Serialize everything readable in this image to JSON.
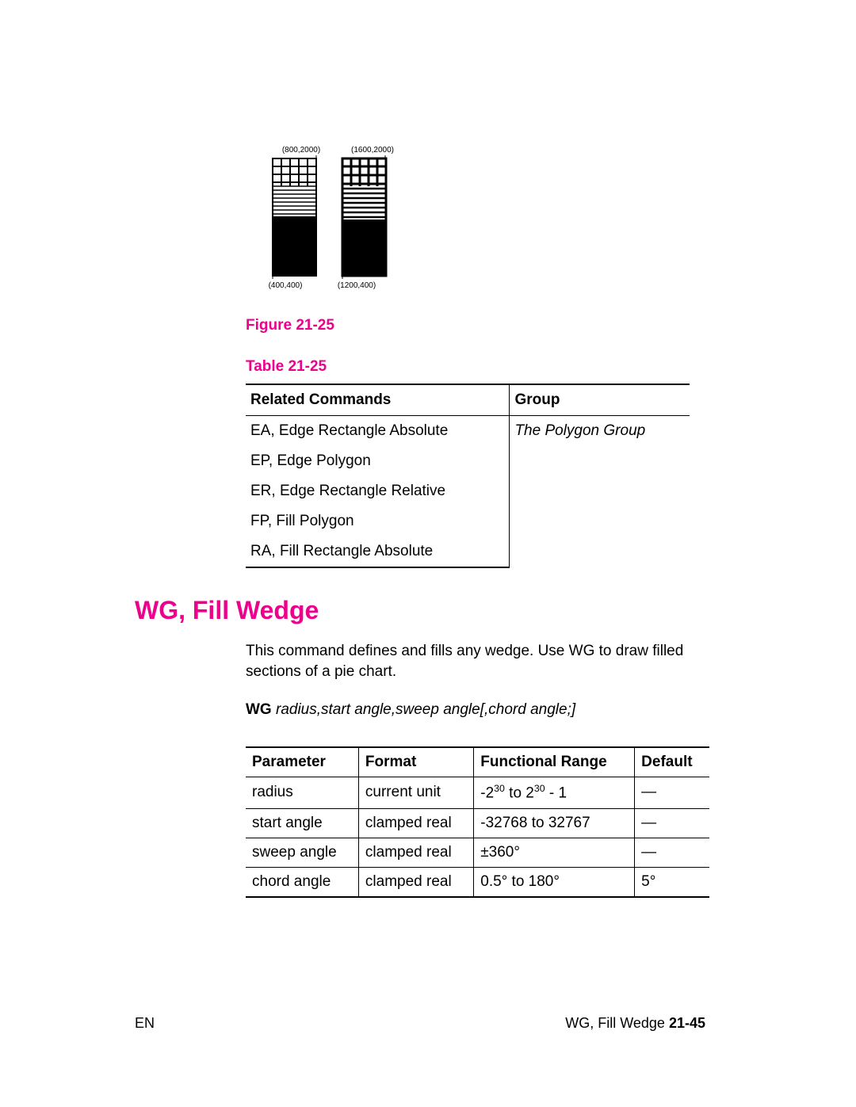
{
  "figure": {
    "caption": "Figure 21-25",
    "coords": {
      "tl": "(800,2000)",
      "tr": "(1600,2000)",
      "bl": "(400,400)",
      "br": "(1200,400)"
    }
  },
  "table1": {
    "caption": "Table 21-25",
    "headers": {
      "c1": "Related Commands",
      "c2": "Group"
    },
    "groupValue": "The Polygon Group",
    "rows": [
      "EA, Edge Rectangle Absolute",
      "EP, Edge Polygon",
      "ER, Edge Rectangle Relative",
      "FP, Fill Polygon",
      "RA, Fill Rectangle Absolute"
    ]
  },
  "section": {
    "title": "WG, Fill Wedge",
    "body": "This command defines and fills any wedge. Use WG to draw filled sections of a pie chart.",
    "syntax_bold": "WG",
    "syntax_italic": " radius,start angle,sweep angle[,chord angle;]"
  },
  "table2": {
    "headers": {
      "c1": "Parameter",
      "c2": "Format",
      "c3": "Functional Range",
      "c4": "Default"
    },
    "rows": [
      {
        "p": "radius",
        "f": "current unit",
        "r_pre": "-2",
        "r_sup1": "30",
        "r_mid": " to 2",
        "r_sup2": "30",
        "r_post": " - 1",
        "d": "—"
      },
      {
        "p": "start angle",
        "f": "clamped real",
        "r_plain": "-32768 to 32767",
        "d": "—"
      },
      {
        "p": "sweep angle",
        "f": "clamped real",
        "r_plain": "±360°",
        "d": "—"
      },
      {
        "p": "chord angle",
        "f": "clamped real",
        "r_plain": "0.5° to 180°",
        "d": "5°"
      }
    ]
  },
  "footer": {
    "left": "EN",
    "right_plain": "WG, Fill Wedge ",
    "right_bold": "21-45"
  }
}
